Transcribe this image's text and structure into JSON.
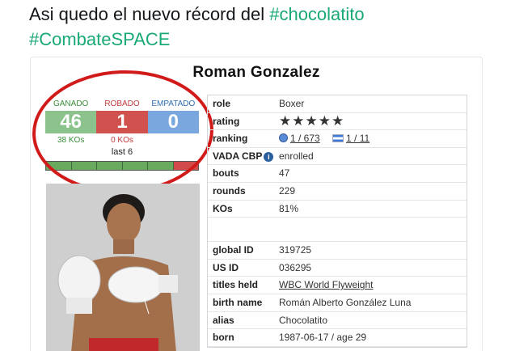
{
  "tweet": {
    "text": "Asi quedo el nuevo récord del",
    "hashtag1": "#chocolatito",
    "hashtag2": "#CombateSPACE"
  },
  "card": {
    "boxer_name": "Roman Gonzalez",
    "record": {
      "won_label": "GANADO",
      "lost_label": "ROBADO",
      "draw_label": "EMPATADO",
      "won": "46",
      "lost": "1",
      "draw": "0",
      "won_kos": "38 KOs",
      "lost_kos": "0 KOs",
      "last_label": "last 6",
      "last6": [
        "win",
        "win",
        "win",
        "win",
        "win",
        "loss"
      ]
    },
    "info": {
      "role_label": "role",
      "role": "Boxer",
      "rating_label": "rating",
      "rating_stars": 5,
      "rating_glyph": "★★★★★",
      "ranking_label": "ranking",
      "ranking_world": "1 / 673",
      "ranking_country": "1 / 11",
      "vada_label": "VADA CBP",
      "vada_icon": "info-icon",
      "vada": "enrolled",
      "bouts_label": "bouts",
      "bouts": "47",
      "rounds_label": "rounds",
      "rounds": "229",
      "kos_label": "KOs",
      "kos": "81%",
      "global_id_label": "global ID",
      "global_id": "319725",
      "us_id_label": "US ID",
      "us_id": "036295",
      "titles_label": "titles held",
      "titles": "WBC World Flyweight",
      "birth_name_label": "birth name",
      "birth_name": "Román Alberto González Luna",
      "alias_label": "alias",
      "alias": "Chocolatito",
      "born_label": "born",
      "born": "1987-06-17 / age 29"
    },
    "colors": {
      "won": "#8cc38c",
      "lost": "#d0514d",
      "draw": "#7aa7dd",
      "annotation_circle": "#d11a1a",
      "hashtag": "#19a974"
    }
  }
}
